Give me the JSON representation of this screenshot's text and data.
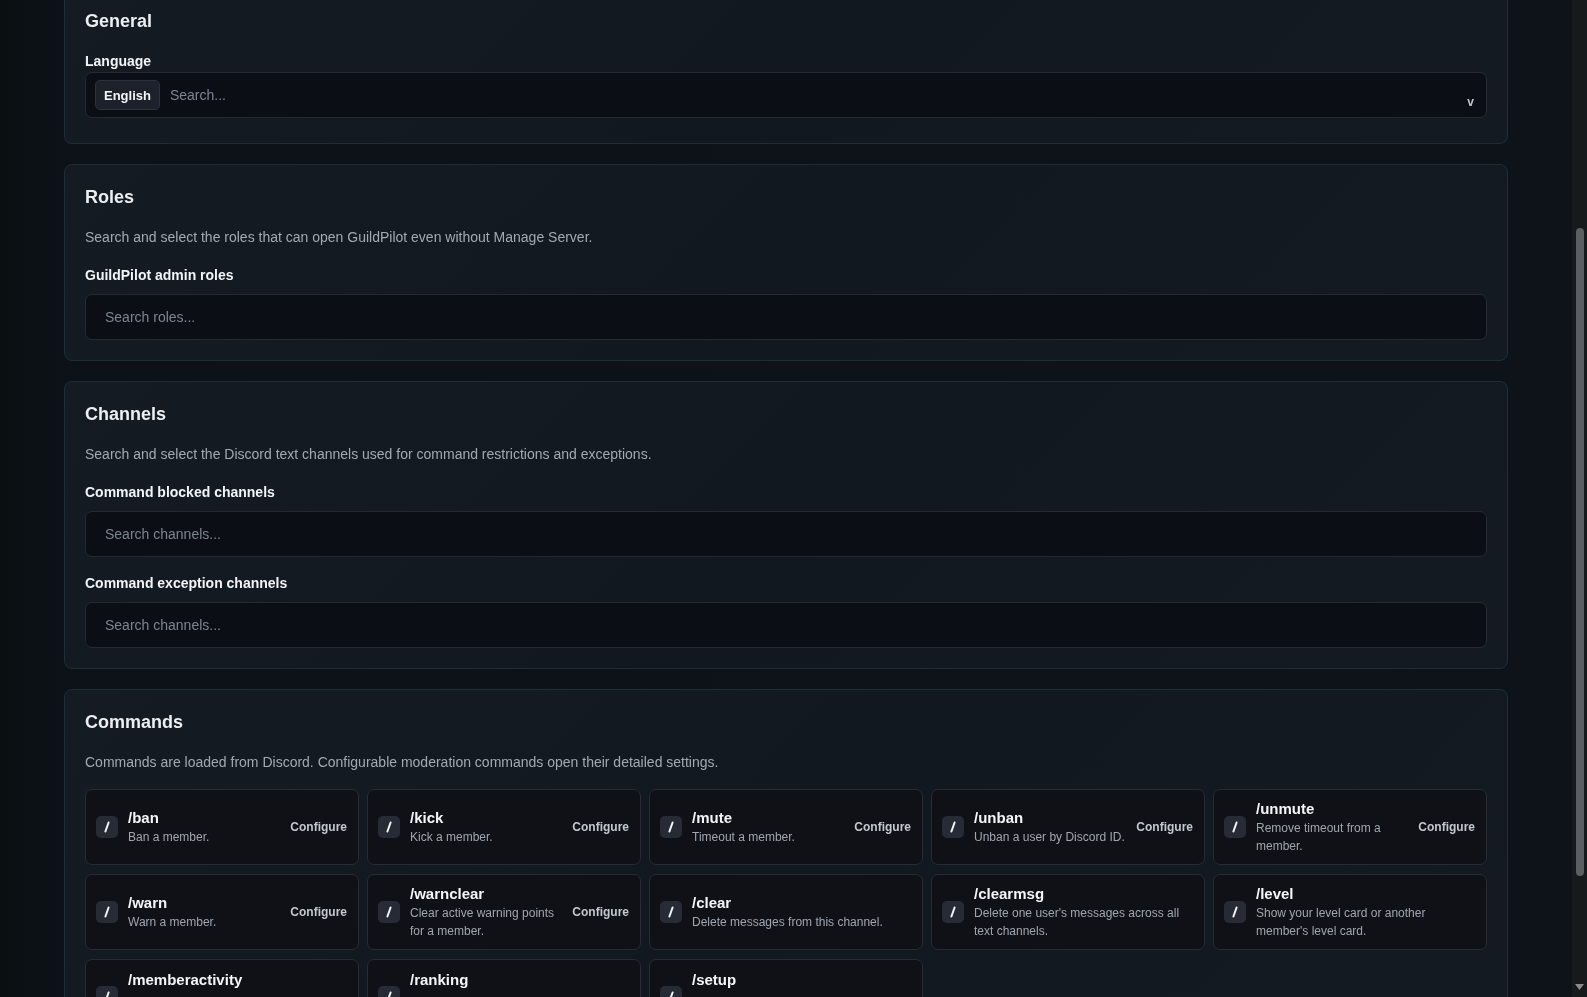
{
  "sections": [
    {
      "title": "General",
      "fields": [
        {
          "kind": "select",
          "label": "Language",
          "chips": [
            "English"
          ],
          "placeholder": "Search...",
          "caret": "v"
        }
      ]
    },
    {
      "title": "Roles",
      "description": "Search and select the roles that can open GuildPilot even without Manage Server.",
      "fields": [
        {
          "kind": "search",
          "label": "GuildPilot admin roles",
          "placeholder": "Search roles..."
        }
      ]
    },
    {
      "title": "Channels",
      "description": "Search and select the Discord text channels used for command restrictions and exceptions.",
      "fields": [
        {
          "kind": "search",
          "label": "Command blocked channels",
          "placeholder": "Search channels..."
        },
        {
          "kind": "search",
          "label": "Command exception channels",
          "placeholder": "Search channels..."
        }
      ]
    },
    {
      "title": "Commands",
      "description": "Commands are loaded from Discord. Configurable moderation commands open their detailed settings.",
      "commands": [
        {
          "name": "/ban",
          "description": "Ban a member.",
          "action": "Configure"
        },
        {
          "name": "/kick",
          "description": "Kick a member.",
          "action": "Configure"
        },
        {
          "name": "/mute",
          "description": "Timeout a member.",
          "action": "Configure"
        },
        {
          "name": "/unban",
          "description": "Unban a user by Discord ID.",
          "action": "Configure"
        },
        {
          "name": "/unmute",
          "description": "Remove timeout from a member.",
          "action": "Configure"
        },
        {
          "name": "/warn",
          "description": "Warn a member.",
          "action": "Configure"
        },
        {
          "name": "/warnclear",
          "description": "Clear active warning points for a member.",
          "action": "Configure"
        },
        {
          "name": "/clear",
          "description": "Delete messages from this channel."
        },
        {
          "name": "/clearmsg",
          "description": "Delete one user's messages across all text channels."
        },
        {
          "name": "/level",
          "description": "Show your level card or another member's level card."
        },
        {
          "name": "/memberactivity"
        },
        {
          "name": "/ranking"
        },
        {
          "name": "/setup"
        }
      ]
    }
  ]
}
